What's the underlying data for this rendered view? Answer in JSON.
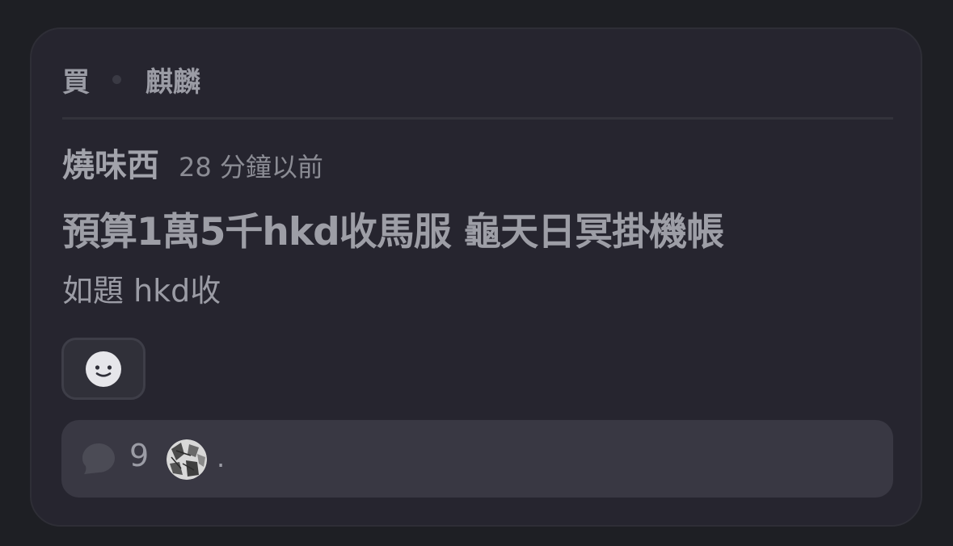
{
  "post": {
    "tags": [
      "買",
      "麒麟"
    ],
    "author": "燒味西",
    "time_ago": "28 分鐘以前",
    "title": "預算1萬5千hkd收馬服 龜天日冥掛機帳",
    "body": "如題 hkd收"
  },
  "footer": {
    "comment_count": "9",
    "more": "."
  },
  "icons": {
    "reaction": "smiley-icon",
    "comment": "comment-bubble-icon",
    "avatar": "user-avatar"
  },
  "colors": {
    "background": "#1e1f24",
    "card": "#26252f",
    "footer": "#393843",
    "text": "#9d9ea6"
  }
}
